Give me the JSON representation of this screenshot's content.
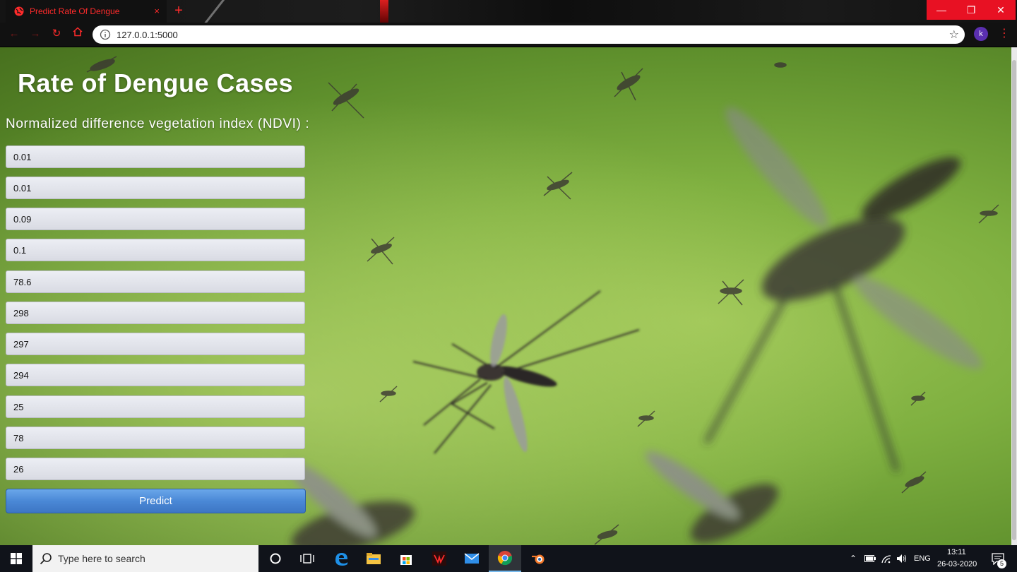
{
  "browser": {
    "tab_title": "Predict Rate Of Dengue",
    "tab_close": "×",
    "new_tab": "+",
    "url": "127.0.0.1:5000",
    "profile_initial": "k",
    "window_controls": {
      "minimize": "—",
      "restore": "❐",
      "close": "✕"
    },
    "accent_color": "#ff2b2b"
  },
  "page": {
    "title": "Rate of Dengue Cases",
    "label": "Normalized difference vegetation index (NDVI) :",
    "fields": [
      "0.01",
      "0.01",
      "0.09",
      "0.1",
      "78.6",
      "298",
      "297",
      "294",
      "25",
      "78",
      "26"
    ],
    "predict_button": "Predict",
    "button_color": "#4a88d6"
  },
  "taskbar": {
    "search_placeholder": "Type here to search",
    "language": "ENG",
    "time": "13:11",
    "date": "26-03-2020",
    "notification_count": "5"
  }
}
